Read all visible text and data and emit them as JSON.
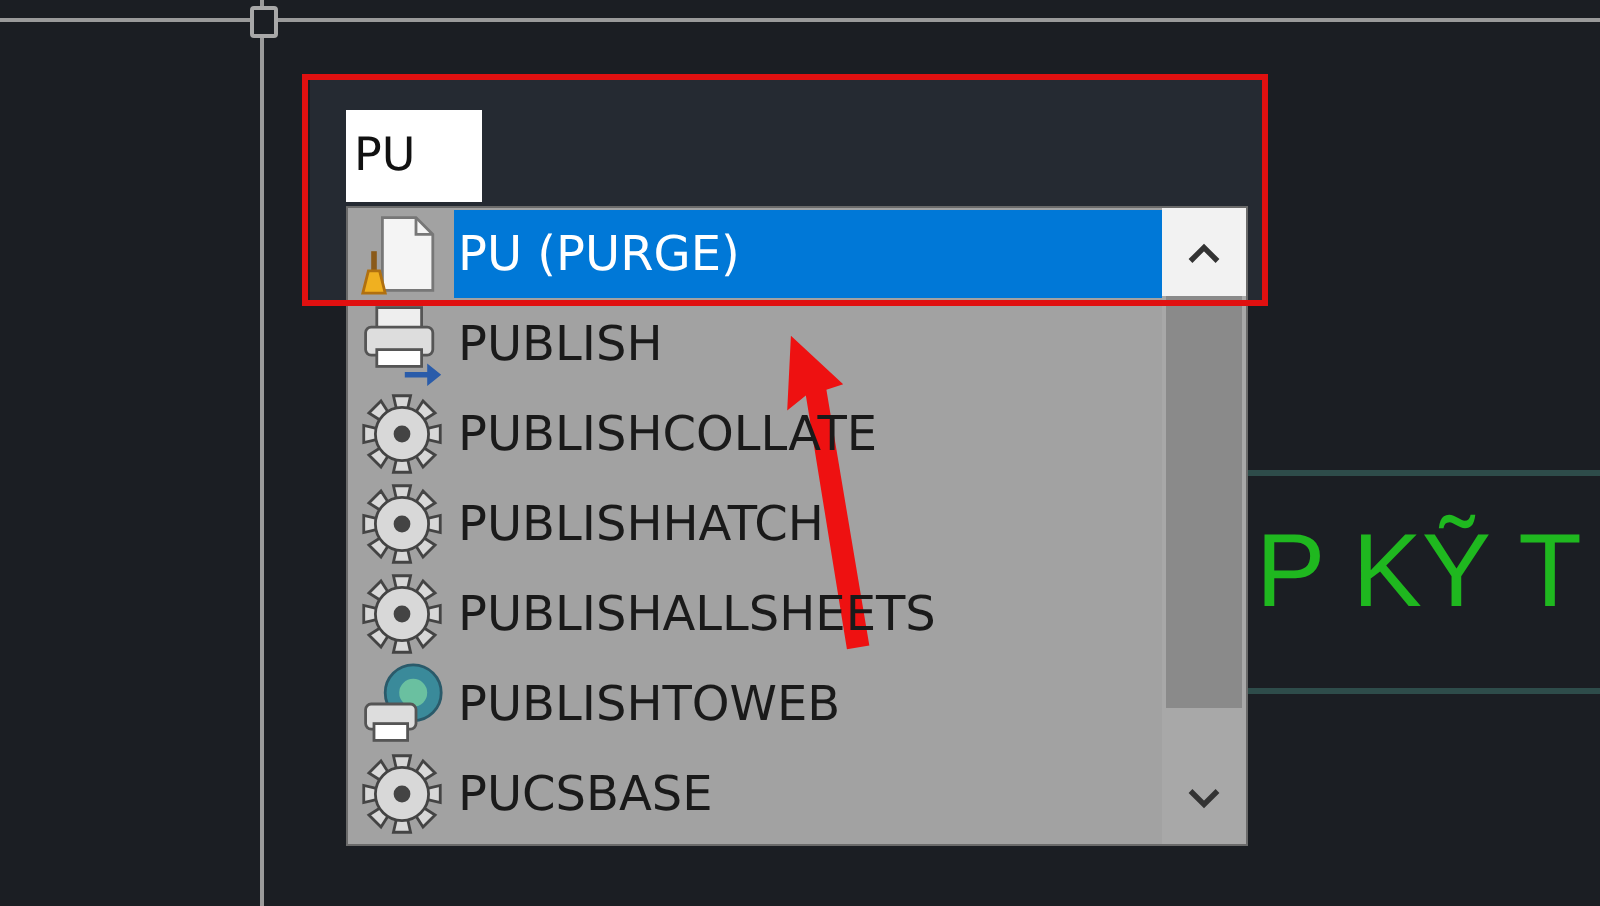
{
  "command_input": {
    "value": "PU"
  },
  "suggestions": [
    {
      "label": "PU (PURGE)",
      "kind": "purge",
      "selected": true
    },
    {
      "label": "PUBLISH",
      "kind": "publish",
      "selected": false
    },
    {
      "label": "PUBLISHCOLLATE",
      "kind": "command",
      "selected": false
    },
    {
      "label": "PUBLISHHATCH",
      "kind": "command",
      "selected": false
    },
    {
      "label": "PUBLISHALLSHEETS",
      "kind": "command",
      "selected": false
    },
    {
      "label": "PUBLISHTOWEB",
      "kind": "web",
      "selected": false
    },
    {
      "label": "PUCSBASE",
      "kind": "command",
      "selected": false
    }
  ],
  "drawing_text": "P KỸ T"
}
